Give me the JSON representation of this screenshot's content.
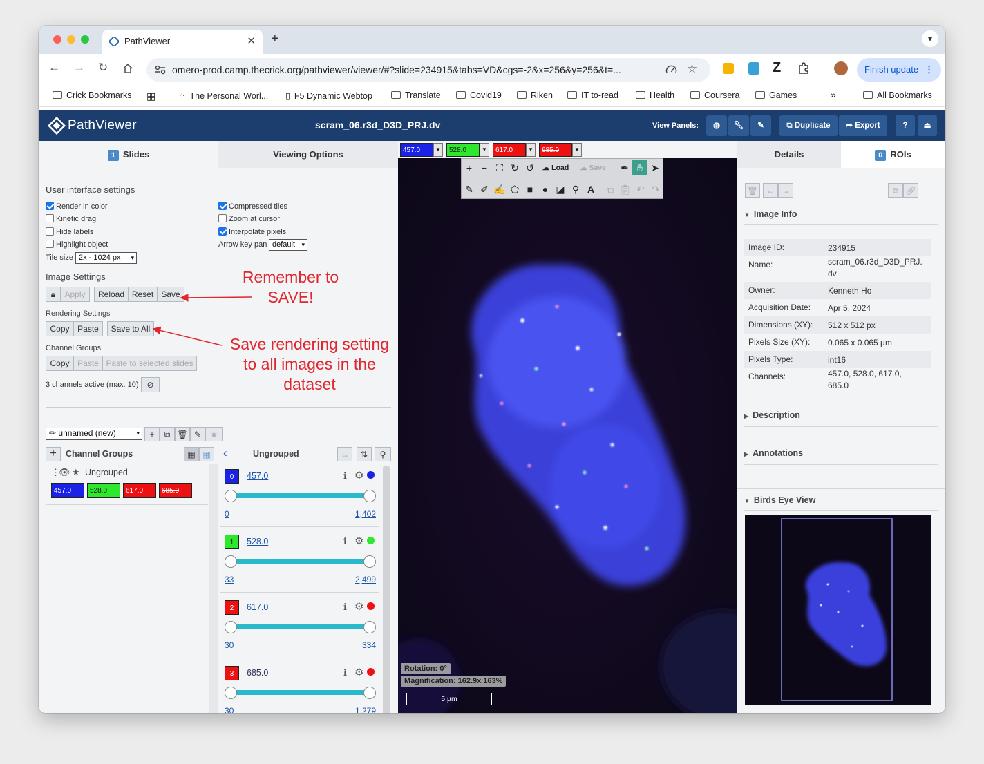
{
  "browser": {
    "tab_title": "PathViewer",
    "url": "omero-prod.camp.thecrick.org/pathviewer/viewer/#?slide=234915&tabs=VD&cgs=-2&x=256&y=256&t=...",
    "finish_update": "Finish update",
    "bookmarks": [
      "Crick Bookmarks",
      "The Personal Worl...",
      "F5 Dynamic Webtop",
      "Translate",
      "Covid19",
      "Riken",
      "IT to-read",
      "Health",
      "Coursera",
      "Games",
      "All Bookmarks"
    ],
    "more": "»"
  },
  "app": {
    "logo": "PathViewer",
    "image_title": "scram_06.r3d_D3D_PRJ.dv",
    "view_panels_label": "View Panels:",
    "duplicate": "Duplicate",
    "export": "Export",
    "help": "?"
  },
  "left": {
    "tab_slides_count": "1",
    "tab_slides": "Slides",
    "tab_viewing": "Viewing Options",
    "ui_settings": "User interface settings",
    "checkboxes": [
      {
        "label": "Render in color",
        "checked": true
      },
      {
        "label": "Kinetic drag",
        "checked": false
      },
      {
        "label": "Hide labels",
        "checked": false
      },
      {
        "label": "Highlight object",
        "checked": false
      },
      {
        "label": "Compressed tiles",
        "checked": true
      },
      {
        "label": "Zoom at cursor",
        "checked": false
      },
      {
        "label": "Interpolate pixels",
        "checked": true
      }
    ],
    "arrow_key_pan": "Arrow key pan",
    "arrow_key_value": "default",
    "tile_size_label": "Tile size",
    "tile_size_value": "2x - 1024 px",
    "image_settings": "Image Settings",
    "apply": "Apply",
    "reload": "Reload",
    "reset": "Reset",
    "save": "Save",
    "rendering_settings": "Rendering Settings",
    "copy": "Copy",
    "paste": "Paste",
    "save_to_all": "Save to All",
    "channel_groups": "Channel Groups",
    "cg_copy": "Copy",
    "cg_paste": "Paste",
    "paste_selected": "Paste to selected slides",
    "channels_active": "3 channels active (max. 10)",
    "preset": "unnamed (new)",
    "cg_header": "Channel Groups",
    "ungrouped_header": "Ungrouped",
    "ungrouped_item": "Ungrouped",
    "note_save": "Remember to SAVE!",
    "note_rendering": "Save rendering setting to all images in the dataset"
  },
  "channels": [
    {
      "index": "0",
      "name": "457.0",
      "min": "0",
      "max": "1,402",
      "color": "#1a22e8",
      "active": true
    },
    {
      "index": "1",
      "name": "528.0",
      "min": "33",
      "max": "2,499",
      "color": "#2ee82e",
      "active": true
    },
    {
      "index": "2",
      "name": "617.0",
      "min": "30",
      "max": "334",
      "color": "#ee1111",
      "active": true
    },
    {
      "index": "3",
      "name": "685.0",
      "min": "30",
      "max": "1,279",
      "color": "#ee1111",
      "active": false
    }
  ],
  "viewer": {
    "load": "Load",
    "save": "Save",
    "rotation": "Rotation:     0°",
    "magnification": "Magnification: 162.9x 163%",
    "scale": "5 µm"
  },
  "right": {
    "tab_details": "Details",
    "tab_rois_count": "0",
    "tab_rois": "ROIs",
    "image_info": "Image Info",
    "info": [
      {
        "k": "Image ID:",
        "v": "234915"
      },
      {
        "k": "Name:",
        "v": "scram_06.r3d_D3D_PRJ.dv"
      },
      {
        "k": "Owner:",
        "v": "Kenneth Ho"
      },
      {
        "k": "Acquisition Date:",
        "v": "Apr 5, 2024"
      },
      {
        "k": "Dimensions (XY):",
        "v": "512 x 512 px"
      },
      {
        "k": "Pixels Size (XY):",
        "v": "0.065 x 0.065 µm"
      },
      {
        "k": "Pixels Type:",
        "v": "int16"
      },
      {
        "k": "Channels:",
        "v": "457.0, 528.0, 617.0, 685.0"
      }
    ],
    "description": "Description",
    "annotations": "Annotations",
    "birds_eye": "Birds Eye View"
  }
}
